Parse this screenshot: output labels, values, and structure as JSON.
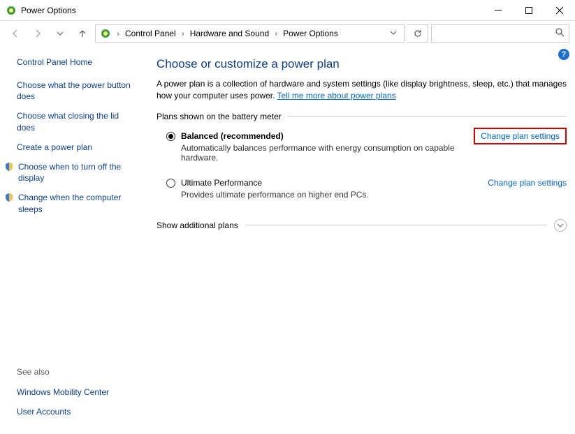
{
  "window": {
    "title": "Power Options"
  },
  "breadcrumbs": {
    "items": [
      "Control Panel",
      "Hardware and Sound",
      "Power Options"
    ]
  },
  "search": {
    "placeholder": ""
  },
  "sidebar": {
    "home": "Control Panel Home",
    "links": [
      "Choose what the power button does",
      "Choose what closing the lid does",
      "Create a power plan",
      "Choose when to turn off the display",
      "Change when the computer sleeps"
    ],
    "seealso_label": "See also",
    "seealso": [
      "Windows Mobility Center",
      "User Accounts"
    ]
  },
  "main": {
    "heading": "Choose or customize a power plan",
    "description_prefix": "A power plan is a collection of hardware and system settings (like display brightness, sleep, etc.) that manages how your computer uses power. ",
    "description_link": "Tell me more about power plans",
    "plans_section_label": "Plans shown on the battery meter",
    "plans": [
      {
        "name": "Balanced (recommended)",
        "desc": "Automatically balances performance with energy consumption on capable hardware.",
        "link": "Change plan settings",
        "selected": true,
        "highlighted": true
      },
      {
        "name": "Ultimate Performance",
        "desc": "Provides ultimate performance on higher end PCs.",
        "link": "Change plan settings",
        "selected": false,
        "highlighted": false
      }
    ],
    "expand_label": "Show additional plans"
  }
}
